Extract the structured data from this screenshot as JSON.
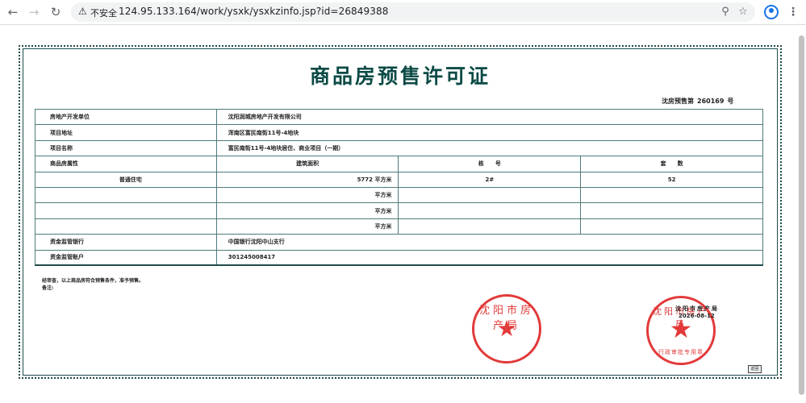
{
  "browser": {
    "back_icon": "arrow-left-icon",
    "forward_icon": "arrow-right-icon",
    "reload_icon": "reload-icon",
    "insecure_label": "不安全",
    "url": "124.95.133.164/work/ysxk/ysxkzinfo.jsp?id=26849388"
  },
  "certificate": {
    "title": "商品房预售许可证",
    "number_prefix": "沈房预售第",
    "number": "260169",
    "number_suffix": "号",
    "rows": {
      "developer_label": "房地产开发单位",
      "developer_value": "沈阳润城房地产开发有限公司",
      "address_label": "项目地址",
      "address_value": "浑南区富民南街11号-4地块",
      "name_label": "项目名称",
      "name_value": "富民南街11号-4地块居住、商业项目（一期）",
      "nature_label": "商品房属性",
      "area_header": "建筑面积",
      "building_header": "栋　　号",
      "units_header": "套　　数",
      "nature_value": "普通住宅",
      "area_value": "5772 平方米",
      "building_value": "2#",
      "units_value": "52",
      "unit_sqm": "平方米",
      "bank_label": "资金监管银行",
      "bank_value": "中国银行沈阳中山支行",
      "account_label": "资金监管账户",
      "account_value": "301245008417"
    },
    "note_line1": "经审查，以上商品房符合预售条件，准予预售。",
    "note_line2": "备注:",
    "issuer": "沈阳市房产局",
    "issue_date": "2026-08-12",
    "back_button": "返回"
  }
}
